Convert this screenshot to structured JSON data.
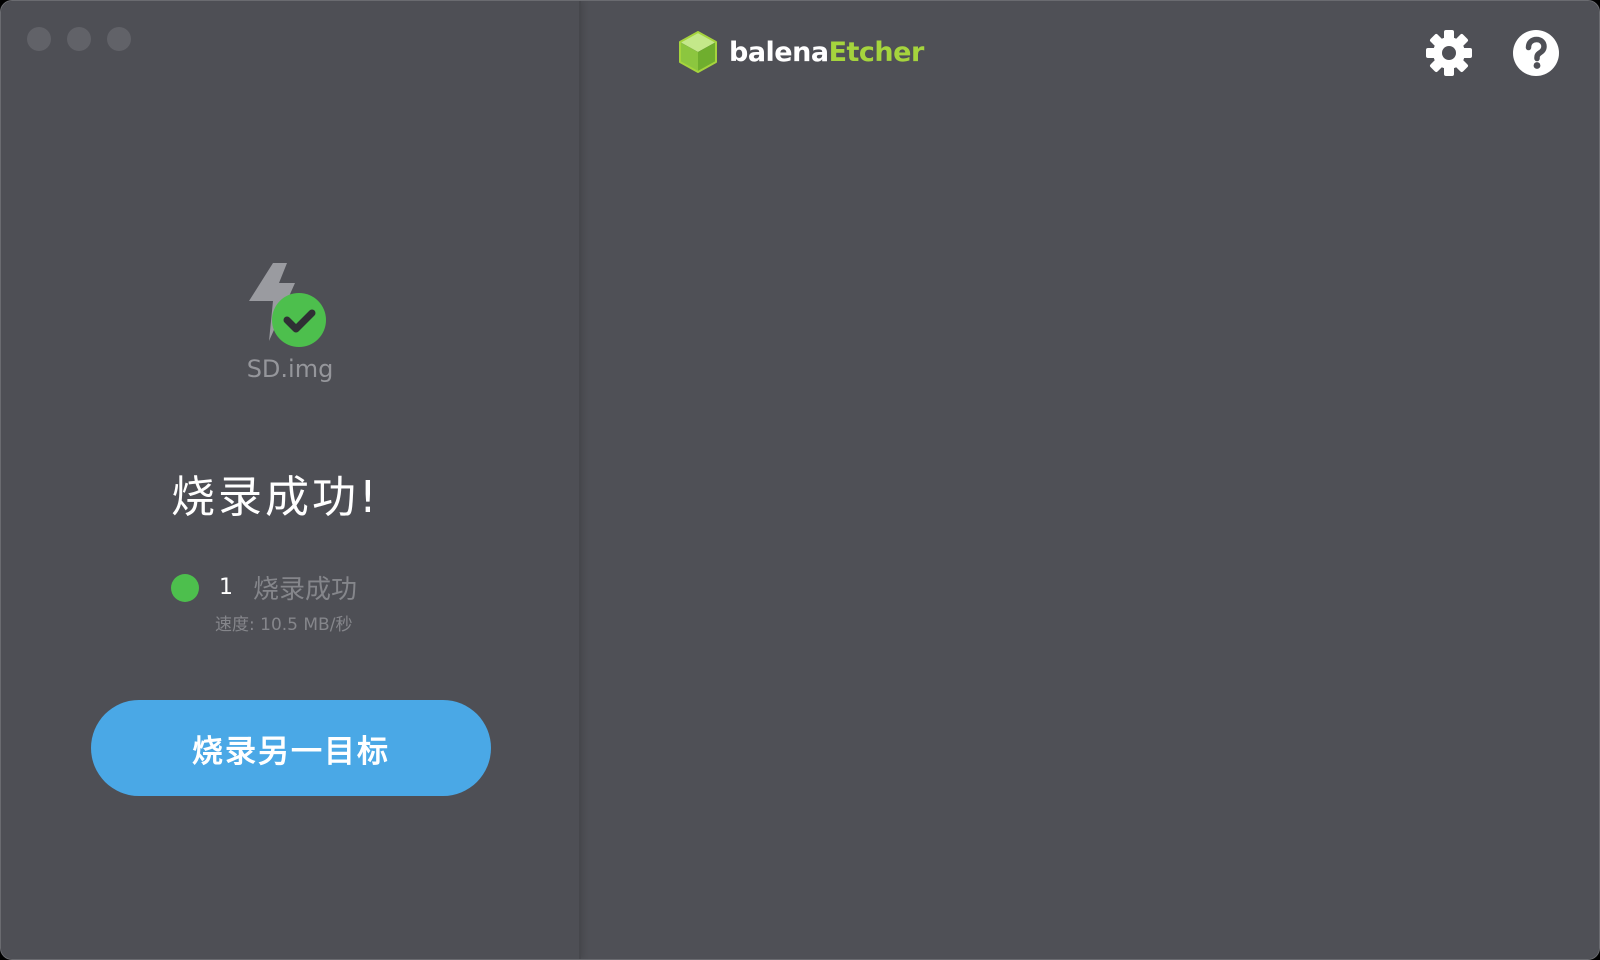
{
  "window": {
    "traffic_lights": [
      "close",
      "minimize",
      "maximize"
    ]
  },
  "header": {
    "logo_part1": "balena",
    "logo_part2": "Etcher",
    "logo_icon": "cube-icon",
    "settings_icon": "gear-icon",
    "help_icon": "question-circle-icon"
  },
  "result": {
    "icon": "flash-success-icon",
    "image_name": "SD.img",
    "title": "烧录成功!",
    "success_count": "1",
    "success_label": "烧录成功",
    "speed": "速度: 10.5 MB/秒",
    "flash_again_label": "烧录另一目标"
  },
  "colors": {
    "background": "#4e4f55",
    "accent_green": "#a5d43d",
    "success_green": "#4dbf4d",
    "button_blue": "#4aa8e6",
    "muted_text": "#85868b"
  }
}
